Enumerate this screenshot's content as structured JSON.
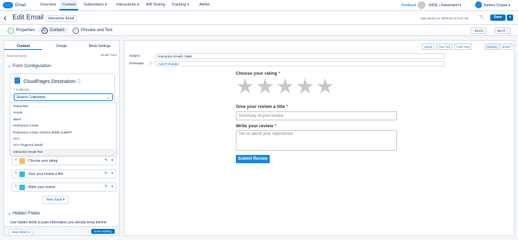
{
  "nav": {
    "brand": "Email",
    "tabs": [
      {
        "label": "Overview"
      },
      {
        "label": "Content"
      },
      {
        "label": "Subscribers"
      },
      {
        "label": "Interactions"
      },
      {
        "label": "A/B Testing"
      },
      {
        "label": "Tracking"
      },
      {
        "label": "Admin"
      }
    ],
    "feedback": "Feedback",
    "account": "WIDE | Switzerland",
    "user": "Stefano Crepaz"
  },
  "titlebar": {
    "title": "Edit Email",
    "email_name": "Interactive Email",
    "saved": "Last saved on 4/6/2020 at 4:42 AM",
    "save_label": "Save"
  },
  "steps": {
    "properties": "Properties",
    "content": "Content",
    "preview": "Preview and Test",
    "back": "‹ BACK",
    "next": "NEXT ›"
  },
  "left": {
    "tabs": [
      "Content",
      "Design",
      "Block Settings"
    ],
    "block_not_saved": "Block not saved",
    "email_form": "Email Form",
    "form_config": "Form Configuration",
    "cp_title": "CloudPages Destination",
    "collection_label": "* Collection",
    "collection_placeholder": "Search Collections",
    "collections": [
      "Teleserbier",
      "Honda",
      "albert",
      "Preference Center",
      "Preference Center CROSS WIDE ALBERT",
      "ACA",
      "ACA Triggered Sends",
      "Interactive Email Test"
    ],
    "fields": [
      "Choose your rating",
      "Give your review a title",
      "Write your review"
    ],
    "new_input": "New Input",
    "hidden_fields": "Hidden Fields",
    "hidden_desc": "Use hidden fields to pass information you already know behind",
    "save_block": "Save Block",
    "done_editing": "Done Editing"
  },
  "right": {
    "view_buttons": [
      "Layout",
      "Plain Text",
      "Code View",
      "Desktop",
      "Mobile"
    ],
    "subject_label": "Subject",
    "subject_value": "Interactive Emails, Mate!",
    "preheader_label": "Preheader",
    "preheader_value": "Add Preheader",
    "rating_label": "Choose your rating",
    "title_label": "Give your review a title",
    "title_placeholder": "Summary of your review",
    "review_label": "Write your review",
    "review_placeholder": "Tell us about your experience",
    "submit": "Submit Review",
    "required_mark": "*"
  }
}
